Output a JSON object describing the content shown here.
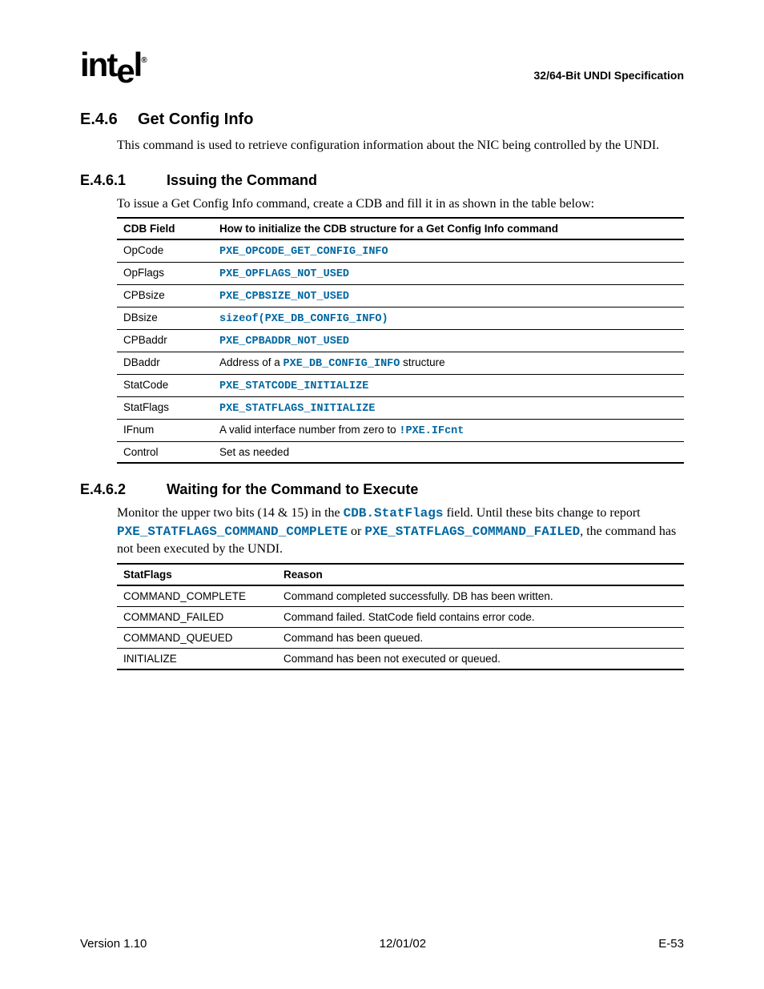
{
  "header": {
    "logo_text": "intel",
    "spec": "32/64-Bit UNDI Specification"
  },
  "s46": {
    "num": "E.4.6",
    "title": "Get Config Info",
    "intro": "This command is used to retrieve configuration information about the NIC being controlled by the UNDI."
  },
  "s461": {
    "num": "E.4.6.1",
    "title": "Issuing the Command",
    "intro": "To issue a Get Config Info command, create a CDB and fill it in as shown in the table below:",
    "th1": "CDB Field",
    "th2": "How to initialize the CDB structure for a Get Config Info command",
    "rows": {
      "r0": {
        "f": "OpCode",
        "v": "PXE_OPCODE_GET_CONFIG_INFO"
      },
      "r1": {
        "f": "OpFlags",
        "v": "PXE_OPFLAGS_NOT_USED"
      },
      "r2": {
        "f": "CPBsize",
        "v": "PXE_CPBSIZE_NOT_USED"
      },
      "r3": {
        "f": "DBsize",
        "v": "sizeof(PXE_DB_CONFIG_INFO)"
      },
      "r4": {
        "f": "CPBaddr",
        "v": "PXE_CPBADDR_NOT_USED"
      },
      "r5": {
        "f": "DBaddr",
        "pre": "Address of a ",
        "code": "PXE_DB_CONFIG_INFO",
        "post": " structure"
      },
      "r6": {
        "f": "StatCode",
        "v": "PXE_STATCODE_INITIALIZE"
      },
      "r7": {
        "f": "StatFlags",
        "v": "PXE_STATFLAGS_INITIALIZE"
      },
      "r8": {
        "f": "IFnum",
        "pre": "A valid interface number from zero to ",
        "code": "!PXE.IFcnt"
      },
      "r9": {
        "f": "Control",
        "plain": "Set as needed"
      }
    }
  },
  "s462": {
    "num": "E.4.6.2",
    "title": "Waiting for the Command to Execute",
    "p1a": "Monitor the upper two bits (14 & 15) in the ",
    "p1code1": "CDB.StatFlags",
    "p1b": " field.  Until these bits change to report ",
    "p1code2": "PXE_STATFLAGS_COMMAND_COMPLETE",
    "p1c": " or ",
    "p1code3": "PXE_STATFLAGS_COMMAND_FAILED",
    "p1d": ", the command has not been executed by the UNDI.",
    "th1": "StatFlags",
    "th2": "Reason",
    "rows": {
      "r0": {
        "f": "COMMAND_COMPLETE",
        "r": "Command completed successfully.  DB has been written."
      },
      "r1": {
        "f": "COMMAND_FAILED",
        "r": "Command failed.  StatCode field contains error code."
      },
      "r2": {
        "f": "COMMAND_QUEUED",
        "r": "Command has been queued."
      },
      "r3": {
        "f": "INITIALIZE",
        "r": "Command has been not executed or queued."
      }
    }
  },
  "footer": {
    "version": "Version 1.10",
    "date": "12/01/02",
    "page": "E-53"
  }
}
